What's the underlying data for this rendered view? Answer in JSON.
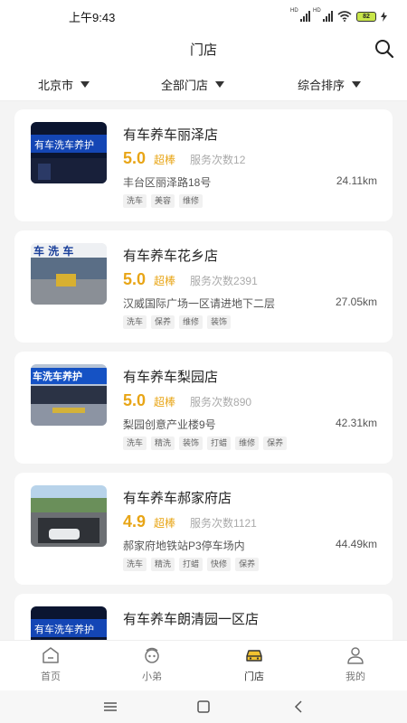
{
  "status_bar": {
    "time": "上午9:43",
    "battery": "82"
  },
  "header": {
    "title": "门店"
  },
  "filters": [
    {
      "label": "北京市"
    },
    {
      "label": "全部门店"
    },
    {
      "label": "综合排序"
    }
  ],
  "stores": [
    {
      "name": "有车养车丽泽店",
      "score": "5.0",
      "grade": "超棒",
      "service_count": "服务次数12",
      "address": "丰台区丽泽路18号",
      "distance": "24.11km",
      "tags": [
        "洗车",
        "美容",
        "维修"
      ],
      "thumb_sign": "有车洗车养护"
    },
    {
      "name": "有车养车花乡店",
      "score": "5.0",
      "grade": "超棒",
      "service_count": "服务次数2391",
      "address": "汉威国际广场一区请进地下二层",
      "distance": "27.05km",
      "tags": [
        "洗车",
        "保养",
        "维修",
        "装饰"
      ],
      "thumb_sign": "车 洗 车"
    },
    {
      "name": "有车养车梨园店",
      "score": "5.0",
      "grade": "超棒",
      "service_count": "服务次数890",
      "address": "梨园创意产业楼9号",
      "distance": "42.31km",
      "tags": [
        "洗车",
        "精洗",
        "装饰",
        "打蜡",
        "维修",
        "保养"
      ],
      "thumb_sign": "车洗车养护"
    },
    {
      "name": "有车养车郝家府店",
      "score": "4.9",
      "grade": "超棒",
      "service_count": "服务次数1121",
      "address": "郝家府地铁站P3停车场内",
      "distance": "44.49km",
      "tags": [
        "洗车",
        "精洗",
        "打蜡",
        "快修",
        "保养"
      ],
      "thumb_sign": ""
    },
    {
      "name": "有车养车朗清园一区店",
      "score": "",
      "grade": "",
      "service_count": "",
      "address": "",
      "distance": "",
      "tags": [],
      "thumb_sign": "有车洗车养护"
    }
  ],
  "tabbar": [
    {
      "label": "首页",
      "icon": "home-icon",
      "active": false
    },
    {
      "label": "小弟",
      "icon": "assistant-icon",
      "active": false
    },
    {
      "label": "门店",
      "icon": "car-icon",
      "active": true
    },
    {
      "label": "我的",
      "icon": "user-icon",
      "active": false
    }
  ],
  "colors": {
    "accent": "#e8a516",
    "active_tab": "#f2c230",
    "background": "#f4f4f4"
  }
}
